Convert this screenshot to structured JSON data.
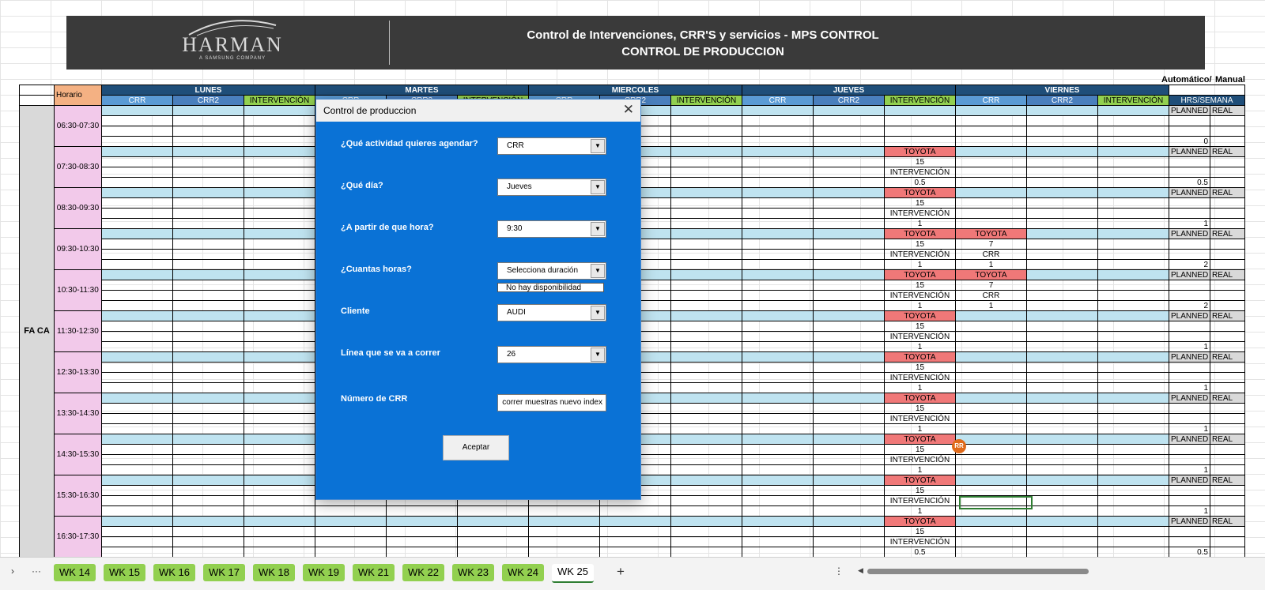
{
  "banner": {
    "logo_text": "HARMAN",
    "logo_sub": "A SAMSUNG COMPANY",
    "title_line1": "Control de Intervenciones, CRR'S y servicios - MPS CONTROL",
    "title_line2": "CONTROL DE PRODUCCION"
  },
  "header_right": {
    "auto_label": "Automático/",
    "manual_label": "Manual",
    "hrs_label": "HRS/SEMANA"
  },
  "grid": {
    "horario_label": "Horario",
    "group_label": "FA CA",
    "days": [
      "LUNES",
      "MARTES",
      "MIERCOLES",
      "JUEVES",
      "VIERNES"
    ],
    "subcols": [
      "CRR",
      "CRR2",
      "INTERVENCIÓN"
    ],
    "planned_label": "PLANNED",
    "real_label": "REAL",
    "slots": [
      {
        "hour": "06:30-07:30",
        "jueves": null,
        "viernes": null,
        "total": "0"
      },
      {
        "hour": "07:30-08:30",
        "jueves": [
          "TOYOTA",
          "15",
          "INTERVENCIÓN",
          "0.5"
        ],
        "viernes": null,
        "total": "0.5"
      },
      {
        "hour": "08:30-09:30",
        "jueves": [
          "TOYOTA",
          "15",
          "INTERVENCIÓN",
          "1"
        ],
        "viernes": null,
        "total": "1"
      },
      {
        "hour": "09:30-10:30",
        "jueves": [
          "TOYOTA",
          "15",
          "INTERVENCIÓN",
          "1"
        ],
        "viernes": [
          "TOYOTA",
          "7",
          "CRR",
          "1"
        ],
        "total": "2"
      },
      {
        "hour": "10:30-11:30",
        "jueves": [
          "TOYOTA",
          "15",
          "INTERVENCIÓN",
          "1"
        ],
        "viernes": [
          "TOYOTA",
          "7",
          "CRR",
          "1"
        ],
        "total": "2"
      },
      {
        "hour": "11:30-12:30",
        "jueves": [
          "TOYOTA",
          "15",
          "INTERVENCIÓN",
          "1"
        ],
        "viernes": null,
        "total": "1"
      },
      {
        "hour": "12:30-13:30",
        "jueves": [
          "TOYOTA",
          "15",
          "INTERVENCIÓN",
          "1"
        ],
        "viernes": null,
        "total": "1"
      },
      {
        "hour": "13:30-14:30",
        "jueves": [
          "TOYOTA",
          "15",
          "INTERVENCIÓN",
          "1"
        ],
        "viernes": null,
        "total": "1"
      },
      {
        "hour": "14:30-15:30",
        "jueves": [
          "TOYOTA",
          "15",
          "INTERVENCIÓN",
          "1"
        ],
        "viernes": null,
        "total": "1"
      },
      {
        "hour": "15:30-16:30",
        "jueves": [
          "TOYOTA",
          "15",
          "INTERVENCIÓN",
          "1"
        ],
        "viernes": null,
        "total": "1"
      },
      {
        "hour": "16:30-17:30",
        "jueves": [
          "TOYOTA",
          "15",
          "INTERVENCIÓN",
          "0.5"
        ],
        "viernes": null,
        "total": "0.5"
      }
    ]
  },
  "comment_badge": "RR",
  "dialog": {
    "title": "Control de produccion",
    "close": "✕",
    "q_activity": "¿Qué actividad quieres agendar?",
    "activity_value": "CRR",
    "q_day": "¿Qué día?",
    "day_value": "Jueves",
    "q_start": "¿A partir de que hora?",
    "start_value": "9:30",
    "q_hours": "¿Cuantas horas?",
    "hours_value": "Selecciona duración",
    "hours_option": "No hay disponibilidad",
    "q_client": "Cliente",
    "client_value": "AUDI",
    "q_line": "Línea que se va a correr",
    "line_value": "26",
    "q_crr": "Número de CRR",
    "crr_value": "correr muestras nuevo index",
    "accept": "Aceptar"
  },
  "tabs": {
    "more": "···",
    "items": [
      "WK 14",
      "WK 15",
      "WK 16",
      "WK 17",
      "WK 18",
      "WK 19",
      "WK 21",
      "WK 22",
      "WK 23",
      "WK 24",
      "WK 25"
    ],
    "active_index": 10,
    "add": "+",
    "options": "⋮"
  },
  "colors": {
    "day_header": "#1f4e79",
    "toyota": "#f07878",
    "dialog": "#0a72d6",
    "tab": "#92d050"
  }
}
